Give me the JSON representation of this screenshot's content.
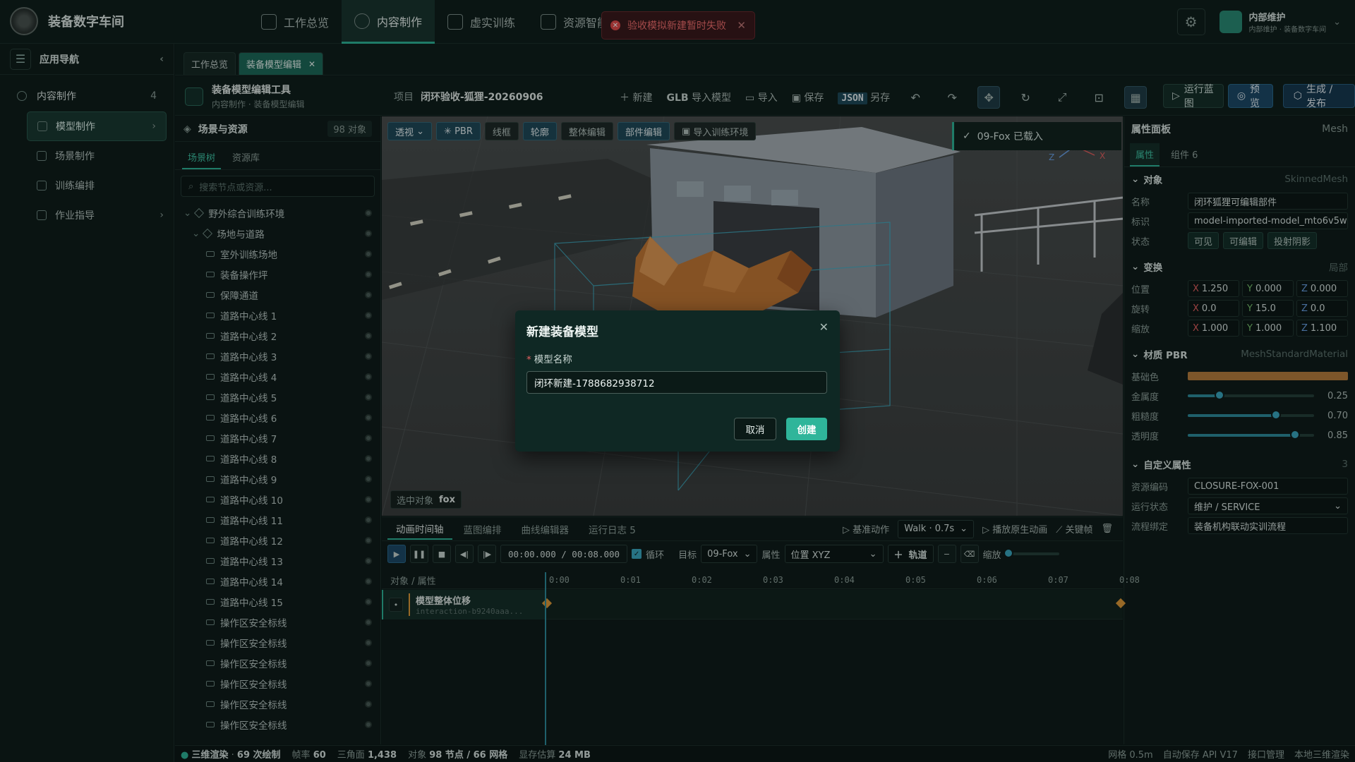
{
  "app": {
    "title": "装备数字车间"
  },
  "nav": [
    {
      "label": "工作总览"
    },
    {
      "label": "内容制作"
    },
    {
      "label": "虚实训练"
    },
    {
      "label": "资源智能"
    }
  ],
  "toast": {
    "text": "验收模拟新建暂时失败"
  },
  "user": {
    "name": "内部维护",
    "sub": "内部维护 · 装备数字车间"
  },
  "left_nav": {
    "title": "应用导航",
    "group": {
      "label": "内容制作",
      "count": "4"
    },
    "items": [
      {
        "label": "模型制作"
      },
      {
        "label": "场景制作"
      },
      {
        "label": "训练编排"
      },
      {
        "label": "作业指导"
      }
    ]
  },
  "tabs": [
    {
      "label": "工作总览"
    },
    {
      "label": "装备模型编辑"
    }
  ],
  "editor": {
    "tool_name": "装备模型编辑工具",
    "breadcrumb": "内容制作 · 装备模型编辑",
    "project_label": "项目",
    "project_name": "闭环验收-狐狸-20260906",
    "new": "新建",
    "glb": "GLB",
    "import_model": "导入模型",
    "import": "导入",
    "save": "保存",
    "json": "JSON",
    "save_as": "另存",
    "run": "运行蓝图",
    "preview": "预览",
    "publish": "生成 / 发布"
  },
  "scene": {
    "title": "场景与资源",
    "count": "98 对象",
    "tabs": [
      "场景树",
      "资源库"
    ],
    "search_placeholder": "搜索节点或资源...",
    "tree": [
      {
        "label": "野外综合训练环境",
        "level": 0,
        "kind": "group"
      },
      {
        "label": "场地与道路",
        "level": 1,
        "kind": "group"
      },
      {
        "label": "室外训练场地",
        "level": 2
      },
      {
        "label": "装备操作坪",
        "level": 2
      },
      {
        "label": "保障通道",
        "level": 2
      },
      {
        "label": "道路中心线 1",
        "level": 2
      },
      {
        "label": "道路中心线 2",
        "level": 2
      },
      {
        "label": "道路中心线 3",
        "level": 2
      },
      {
        "label": "道路中心线 4",
        "level": 2
      },
      {
        "label": "道路中心线 5",
        "level": 2
      },
      {
        "label": "道路中心线 6",
        "level": 2
      },
      {
        "label": "道路中心线 7",
        "level": 2
      },
      {
        "label": "道路中心线 8",
        "level": 2
      },
      {
        "label": "道路中心线 9",
        "level": 2
      },
      {
        "label": "道路中心线 10",
        "level": 2
      },
      {
        "label": "道路中心线 11",
        "level": 2
      },
      {
        "label": "道路中心线 12",
        "level": 2
      },
      {
        "label": "道路中心线 13",
        "level": 2
      },
      {
        "label": "道路中心线 14",
        "level": 2
      },
      {
        "label": "道路中心线 15",
        "level": 2
      },
      {
        "label": "操作区安全标线",
        "level": 2
      },
      {
        "label": "操作区安全标线",
        "level": 2
      },
      {
        "label": "操作区安全标线",
        "level": 2
      },
      {
        "label": "操作区安全标线",
        "level": 2
      },
      {
        "label": "操作区安全标线",
        "level": 2
      },
      {
        "label": "操作区安全标线",
        "level": 2
      }
    ]
  },
  "viewport": {
    "buttons": [
      "透视",
      "PBR",
      "线框",
      "轮廓",
      "整体编辑",
      "部件编辑",
      "导入训练环境"
    ],
    "loaded": "09-Fox 已载入",
    "selected_label": "选中对象",
    "selected_value": "fox",
    "axis": {
      "x": "X",
      "y": "Y",
      "z": "Z"
    }
  },
  "props": {
    "title": "属性面板",
    "type": "Mesh",
    "tabs": [
      "属性",
      "组件 6"
    ],
    "object": {
      "title": "对象",
      "type": "SkinnedMesh",
      "name_label": "名称",
      "name": "闭环狐狸可编辑部件",
      "id_label": "标识",
      "id": "model-imported-model_mto6v5w",
      "state_label": "状态",
      "states": [
        "可见",
        "可编辑",
        "投射阴影"
      ]
    },
    "transform": {
      "title": "变换",
      "scope": "局部",
      "position": {
        "label": "位置",
        "x": "1.250",
        "y": "0.000",
        "z": "0.000"
      },
      "rotation": {
        "label": "旋转",
        "x": "0.0",
        "y": "15.0",
        "z": "0.0"
      },
      "scale": {
        "label": "缩放",
        "x": "1.000",
        "y": "1.000",
        "z": "1.100"
      }
    },
    "material": {
      "title": "材质 PBR",
      "type": "MeshStandardMaterial",
      "base_label": "基础色",
      "base_color": "#b97f3e",
      "metal": {
        "label": "金属度",
        "value": "0.25",
        "fraction": 0.25
      },
      "rough": {
        "label": "粗糙度",
        "value": "0.70",
        "fraction": 0.7
      },
      "opacity": {
        "label": "透明度",
        "value": "0.85",
        "fraction": 0.85
      }
    },
    "custom": {
      "title": "自定义属性",
      "count": "3",
      "code_label": "资源编码",
      "code": "CLOSURE-FOX-001",
      "status_label": "运行状态",
      "status": "维护 / SERVICE",
      "flow_label": "流程绑定",
      "flow": "装备机构联动实训流程"
    }
  },
  "timeline": {
    "tabs": [
      "动画时间轴",
      "蓝图编排",
      "曲线编辑器",
      "运行日志 5"
    ],
    "base_action": "基准动作",
    "walk": "Walk · 0.7s",
    "play_native": "播放原生动画",
    "keyframe": "关键帧",
    "time": "00:00.000 / 00:08.000",
    "loop": "循环",
    "target_label": "目标",
    "target": "09-Fox",
    "prop_label": "属性",
    "prop": "位置 XYZ",
    "add_track": "轨道",
    "zoom": "缩放",
    "col_label": "对象 / 属性",
    "ticks": [
      "0:00",
      "0:01",
      "0:02",
      "0:03",
      "0:04",
      "0:05",
      "0:06",
      "0:07",
      "0:08"
    ],
    "track": {
      "name": "模型整体位移",
      "id": "interaction-b9240aaa..."
    }
  },
  "status": {
    "render": "三维渲染",
    "draw": "69 次绘制",
    "fps_label": "帧率",
    "fps": "60",
    "tri_label": "三角面",
    "tri": "1,438",
    "obj_label": "对象",
    "obj": "98 节点 / 66 网格",
    "mem_label": "显存估算",
    "mem": "24 MB",
    "grid": "网格 0.5m",
    "autosave": "自动保存 API V17",
    "api": "接口管理",
    "local": "本地三维渲染"
  },
  "modal": {
    "title": "新建装备模型",
    "field_label": "模型名称",
    "value": "闭环新建-1788682938712",
    "cancel": "取消",
    "ok": "创建"
  }
}
